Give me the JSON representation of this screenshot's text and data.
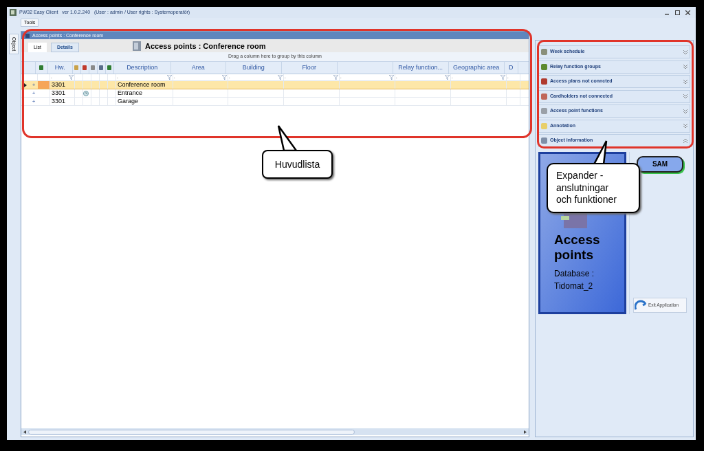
{
  "window": {
    "title": "PW32 Easy Client   ver 1.0.2.240   (User : admin / User rights : Systemoperatör)"
  },
  "menu": [
    "Tools"
  ],
  "side_tab": "Object",
  "panel": {
    "title": "Access points : Conference room",
    "heading": "Access points : Conference room",
    "tabs": [
      {
        "label": "List",
        "selected": true
      },
      {
        "label": "Details",
        "selected": false
      }
    ],
    "group_hint": "Drag a column here to group by this column"
  },
  "columns": [
    {
      "kind": "icon"
    },
    {
      "kind": "text",
      "label": "Hw.",
      "filter": ":"
    },
    {
      "kind": "icon"
    },
    {
      "kind": "icon"
    },
    {
      "kind": "icon"
    },
    {
      "kind": "icon"
    },
    {
      "kind": "icon"
    },
    {
      "kind": "text",
      "label": "Description",
      "filter": ":"
    },
    {
      "kind": "text",
      "label": "Area",
      "filter": ":"
    },
    {
      "kind": "text",
      "label": "Building",
      "filter": ":"
    },
    {
      "kind": "text",
      "label": "Floor",
      "filter": ":"
    },
    {
      "kind": "blank",
      "filter": ":"
    },
    {
      "kind": "text",
      "label": "Relay function...",
      "filter": ":"
    },
    {
      "kind": "text",
      "label": "Geographic area",
      "filter": ":"
    },
    {
      "kind": "text",
      "label": "D",
      "filter": ":"
    }
  ],
  "rows": [
    {
      "expand": "+",
      "hw": "3301",
      "description": "Conference room",
      "selected": true,
      "clock": false
    },
    {
      "expand": "+",
      "hw": "3301",
      "description": "Entrance",
      "selected": false,
      "clock": true
    },
    {
      "expand": "+",
      "hw": "3301",
      "description": "Garage",
      "selected": false,
      "clock": false
    }
  ],
  "expanders": [
    {
      "label": "Week schedule",
      "expanded": false,
      "color": "#8a8f7a"
    },
    {
      "label": "Relay function groups",
      "expanded": false,
      "color": "#5d8a2e"
    },
    {
      "label": "Access plans not conncted",
      "expanded": false,
      "color": "#b03a2e"
    },
    {
      "label": "Cardholders not connected",
      "expanded": false,
      "color": "#c0675a"
    },
    {
      "label": "Access point functions",
      "expanded": false,
      "color": "#9aa0a8"
    },
    {
      "label": "Annotation",
      "expanded": false,
      "color": "#e8cf6a"
    },
    {
      "label": "Object information",
      "expanded": true,
      "color": "#7f8fa8"
    }
  ],
  "tile": {
    "title": "Access points",
    "database": "Database : Tidomat_2"
  },
  "sam_button": "SAM",
  "exit_button": "Exit Application",
  "callouts": [
    {
      "text": "Huvudlista"
    },
    {
      "text": "Expander - anslutningar och funktioner"
    }
  ]
}
